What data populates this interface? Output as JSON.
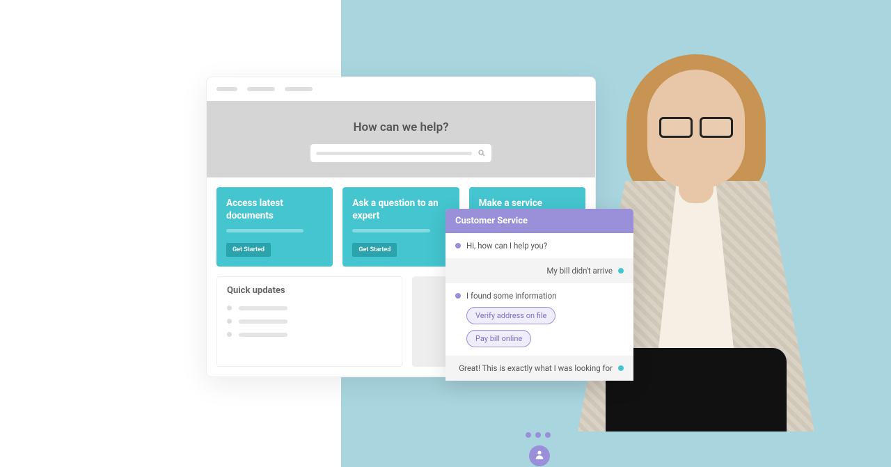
{
  "hero": {
    "title": "How can we help?"
  },
  "cards": [
    {
      "title": "Access latest documents",
      "button": "Get Started"
    },
    {
      "title": "Ask a question to an expert",
      "button": "Get Started"
    },
    {
      "title": "Make a service request",
      "button": ""
    }
  ],
  "quick_updates": {
    "title": "Quick updates"
  },
  "chat": {
    "header": "Customer Service",
    "messages": [
      {
        "from": "agent",
        "text": "Hi, how can I help you?"
      },
      {
        "from": "user",
        "text": "My bill didn't arrive"
      },
      {
        "from": "agent",
        "text": "I found some information"
      },
      {
        "from": "user",
        "text": "Great! This is exactly what I was looking for"
      }
    ],
    "chips": [
      "Verify address on file",
      "Pay bill online"
    ]
  },
  "colors": {
    "teal": "#44c5cf",
    "purple": "#9a8fd9",
    "bg_teal": "#a8d5de"
  }
}
